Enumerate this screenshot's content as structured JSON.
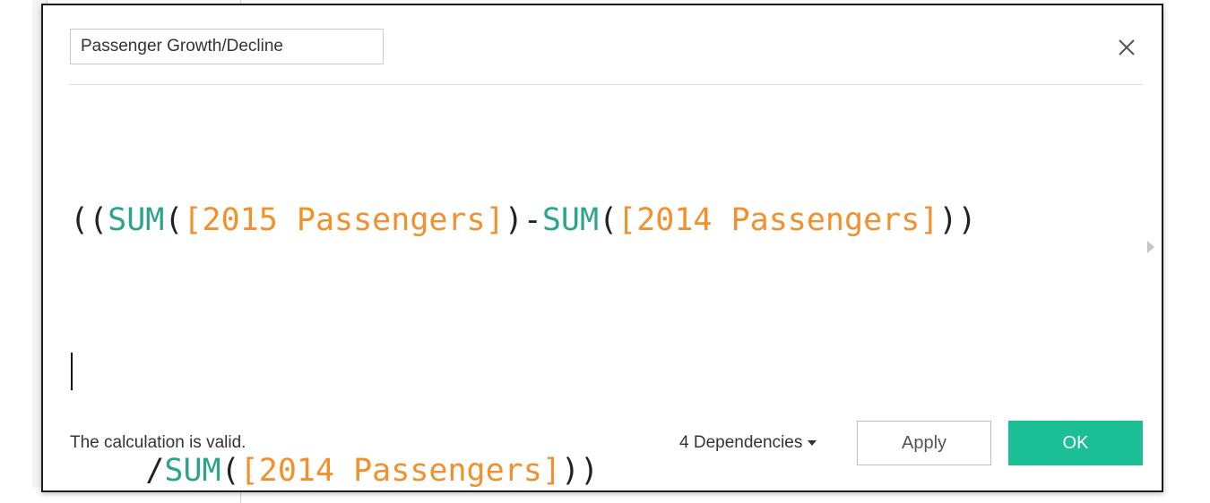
{
  "calculation": {
    "name": "Passenger Growth/Decline",
    "formula_lines": [
      [
        {
          "text": "((",
          "type": "paren"
        },
        {
          "text": "SUM",
          "type": "func"
        },
        {
          "text": "(",
          "type": "paren"
        },
        {
          "text": "[2015 Passengers]",
          "type": "field"
        },
        {
          "text": ")-",
          "type": "paren"
        },
        {
          "text": "SUM",
          "type": "func"
        },
        {
          "text": "(",
          "type": "paren"
        },
        {
          "text": "[2014 Passengers]",
          "type": "field"
        },
        {
          "text": "))",
          "type": "paren"
        }
      ],
      [
        {
          "text": "/",
          "type": "paren"
        },
        {
          "text": "SUM",
          "type": "func"
        },
        {
          "text": "(",
          "type": "paren"
        },
        {
          "text": "[2014 Passengers]",
          "type": "field"
        },
        {
          "text": "))",
          "type": "paren"
        }
      ]
    ]
  },
  "footer": {
    "status": "The calculation is valid.",
    "dependencies_label": "4 Dependencies",
    "apply_label": "Apply",
    "ok_label": "OK"
  },
  "icons": {
    "close": "close-icon",
    "dependencies_dropdown": "caret-down-icon",
    "expand": "expand-arrow-icon"
  },
  "colors": {
    "function": "#2aa58a",
    "field": "#f2902c",
    "accent": "#1bbf96",
    "text": "#333333"
  }
}
